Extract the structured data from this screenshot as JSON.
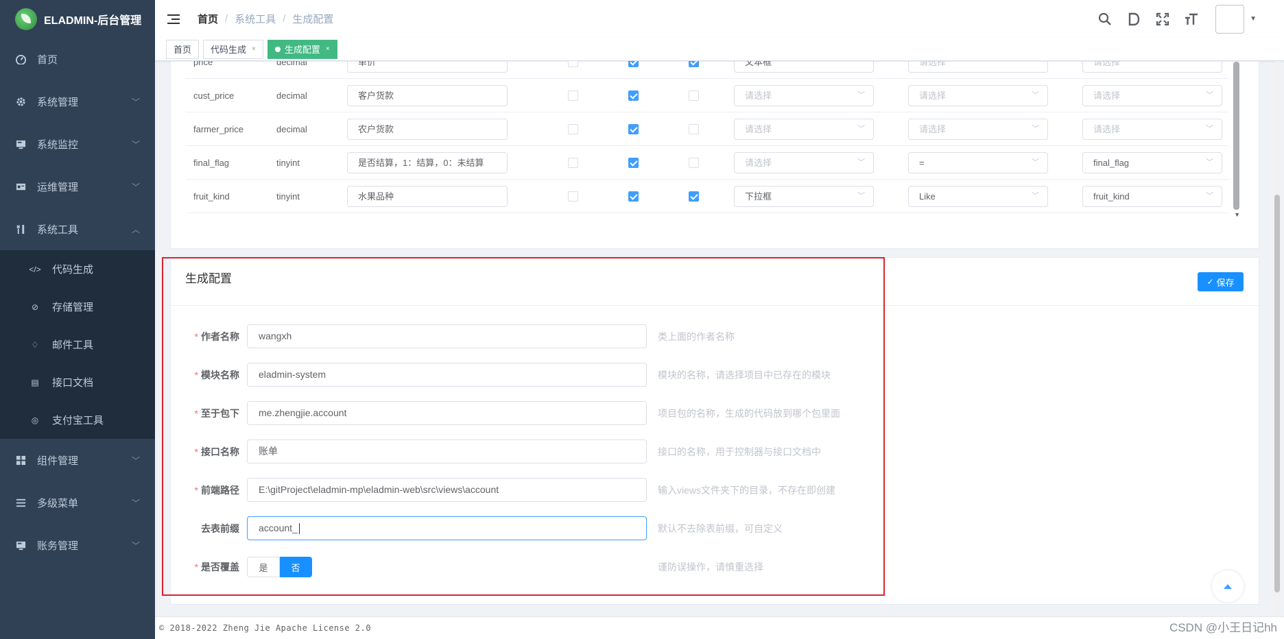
{
  "app": {
    "title": "ELADMIN-后台管理"
  },
  "sidebar": {
    "items": [
      {
        "label": "首页",
        "icon": "dashboard-icon"
      },
      {
        "label": "系统管理",
        "icon": "gear-icon"
      },
      {
        "label": "系统监控",
        "icon": "monitor-icon"
      },
      {
        "label": "运维管理",
        "icon": "server-icon"
      },
      {
        "label": "系统工具",
        "icon": "tools-icon",
        "expanded": true
      }
    ],
    "subitems": [
      {
        "label": "代码生成",
        "icon": "code-icon"
      },
      {
        "label": "存储管理",
        "icon": "storage-icon"
      },
      {
        "label": "邮件工具",
        "icon": "bell-icon"
      },
      {
        "label": "接口文档",
        "icon": "doc-icon"
      },
      {
        "label": "支付宝工具",
        "icon": "alipay-icon"
      }
    ],
    "items_after": [
      {
        "label": "组件管理",
        "icon": "grid-icon"
      },
      {
        "label": "多级菜单",
        "icon": "list-icon"
      },
      {
        "label": "账务管理",
        "icon": "monitor-icon"
      }
    ]
  },
  "navbar": {
    "breadcrumb": [
      "首页",
      "系统工具",
      "生成配置"
    ],
    "separator": "/"
  },
  "tags": [
    {
      "label": "首页",
      "active": false,
      "closable": false
    },
    {
      "label": "代码生成",
      "active": false,
      "closable": true
    },
    {
      "label": "生成配置",
      "active": true,
      "closable": true
    }
  ],
  "close_glyph": "×",
  "field_table": {
    "rows": [
      {
        "name": "price",
        "type": "decimal",
        "remark": "单价",
        "cb1": false,
        "cb2": true,
        "cb3": true,
        "form_type": "文本框",
        "query_type": "请选择",
        "dict": "请选择"
      },
      {
        "name": "cust_price",
        "type": "decimal",
        "remark": "客户货款",
        "cb1": false,
        "cb2": true,
        "cb3": false,
        "form_type": "请选择",
        "query_type": "请选择",
        "dict": "请选择"
      },
      {
        "name": "farmer_price",
        "type": "decimal",
        "remark": "农户货款",
        "cb1": false,
        "cb2": true,
        "cb3": false,
        "form_type": "请选择",
        "query_type": "请选择",
        "dict": "请选择"
      },
      {
        "name": "final_flag",
        "type": "tinyint",
        "remark": "是否结算，1：结算，0：未结算",
        "cb1": false,
        "cb2": true,
        "cb3": false,
        "form_type": "请选择",
        "query_type": "=",
        "dict": "final_flag"
      },
      {
        "name": "fruit_kind",
        "type": "tinyint",
        "remark": "水果品种",
        "cb1": false,
        "cb2": true,
        "cb3": true,
        "form_type": "下拉框",
        "query_type": "Like",
        "dict": "fruit_kind"
      }
    ],
    "placeholder": "请选择"
  },
  "config": {
    "title": "生成配置",
    "save_label": "保存",
    "fields": [
      {
        "label": "作者名称",
        "required": true,
        "value": "wangxh",
        "hint": "类上面的作者名称"
      },
      {
        "label": "模块名称",
        "required": true,
        "value": "eladmin-system",
        "hint": "模块的名称，请选择项目中已存在的模块"
      },
      {
        "label": "至于包下",
        "required": true,
        "value": "me.zhengjie.account",
        "hint": "项目包的名称，生成的代码放到哪个包里面"
      },
      {
        "label": "接口名称",
        "required": true,
        "value": "账单",
        "hint": "接口的名称，用于控制器与接口文档中"
      },
      {
        "label": "前端路径",
        "required": true,
        "value": "E:\\gitProject\\eladmin-mp\\eladmin-web\\src\\views\\account",
        "hint": "输入views文件夹下的目录，不存在即创建"
      },
      {
        "label": "去表前缀",
        "required": false,
        "value": "account_",
        "hint": "默认不去除表前缀，可自定义"
      }
    ],
    "cover": {
      "label": "是否覆盖",
      "required": true,
      "options": [
        "是",
        "否"
      ],
      "selected": "否",
      "hint": "谨防误操作，请慎重选择"
    }
  },
  "footer": {
    "text": "© 2018-2022 Zheng Jie Apache License 2.0"
  },
  "watermark": "CSDN @小王日记hh",
  "colors": {
    "sidebar_bg": "#304156",
    "accent": "#1890ff",
    "tag_active": "#42b983",
    "highlight": "#d9232e"
  }
}
